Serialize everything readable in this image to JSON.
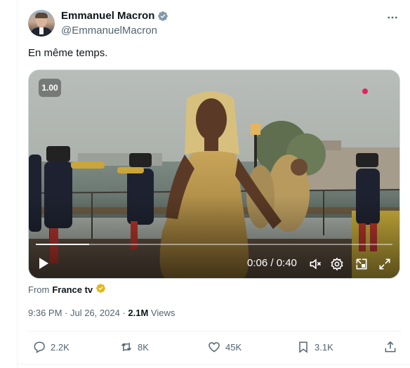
{
  "author": {
    "display_name": "Emmanuel Macron",
    "handle": "@EmmanuelMacron"
  },
  "tweet": {
    "text": "En même temps."
  },
  "video": {
    "speed": "1.00",
    "time": "0:06 / 0:40",
    "progress": 0.15
  },
  "source": {
    "prefix": "From",
    "name": "France tv"
  },
  "meta": {
    "time": "9:36 PM",
    "separator1": " · ",
    "date": "Jul 26, 2024",
    "separator2": " · ",
    "views": "2.1M",
    "views_label": " Views"
  },
  "actions": {
    "replies": "2.2K",
    "reposts": "8K",
    "likes": "45K",
    "bookmarks": "3.1K"
  },
  "colors": {
    "text_primary": "#0f1419",
    "text_secondary": "#536471",
    "verified_blue": "#1d9bf0",
    "verified_gold": "#e2b719",
    "live_red": "#e0245e"
  },
  "icons": {
    "verified": "verified-badge-icon",
    "more": "more-dots-icon",
    "play": "play-icon",
    "mute": "volume-muted-icon",
    "settings": "gear-icon",
    "pip": "picture-in-picture-icon",
    "fullscreen": "fullscreen-icon",
    "gold_check": "gold-verified-icon",
    "reply": "reply-icon",
    "repost": "repost-icon",
    "like": "heart-icon",
    "bookmark": "bookmark-icon",
    "share": "share-icon"
  }
}
